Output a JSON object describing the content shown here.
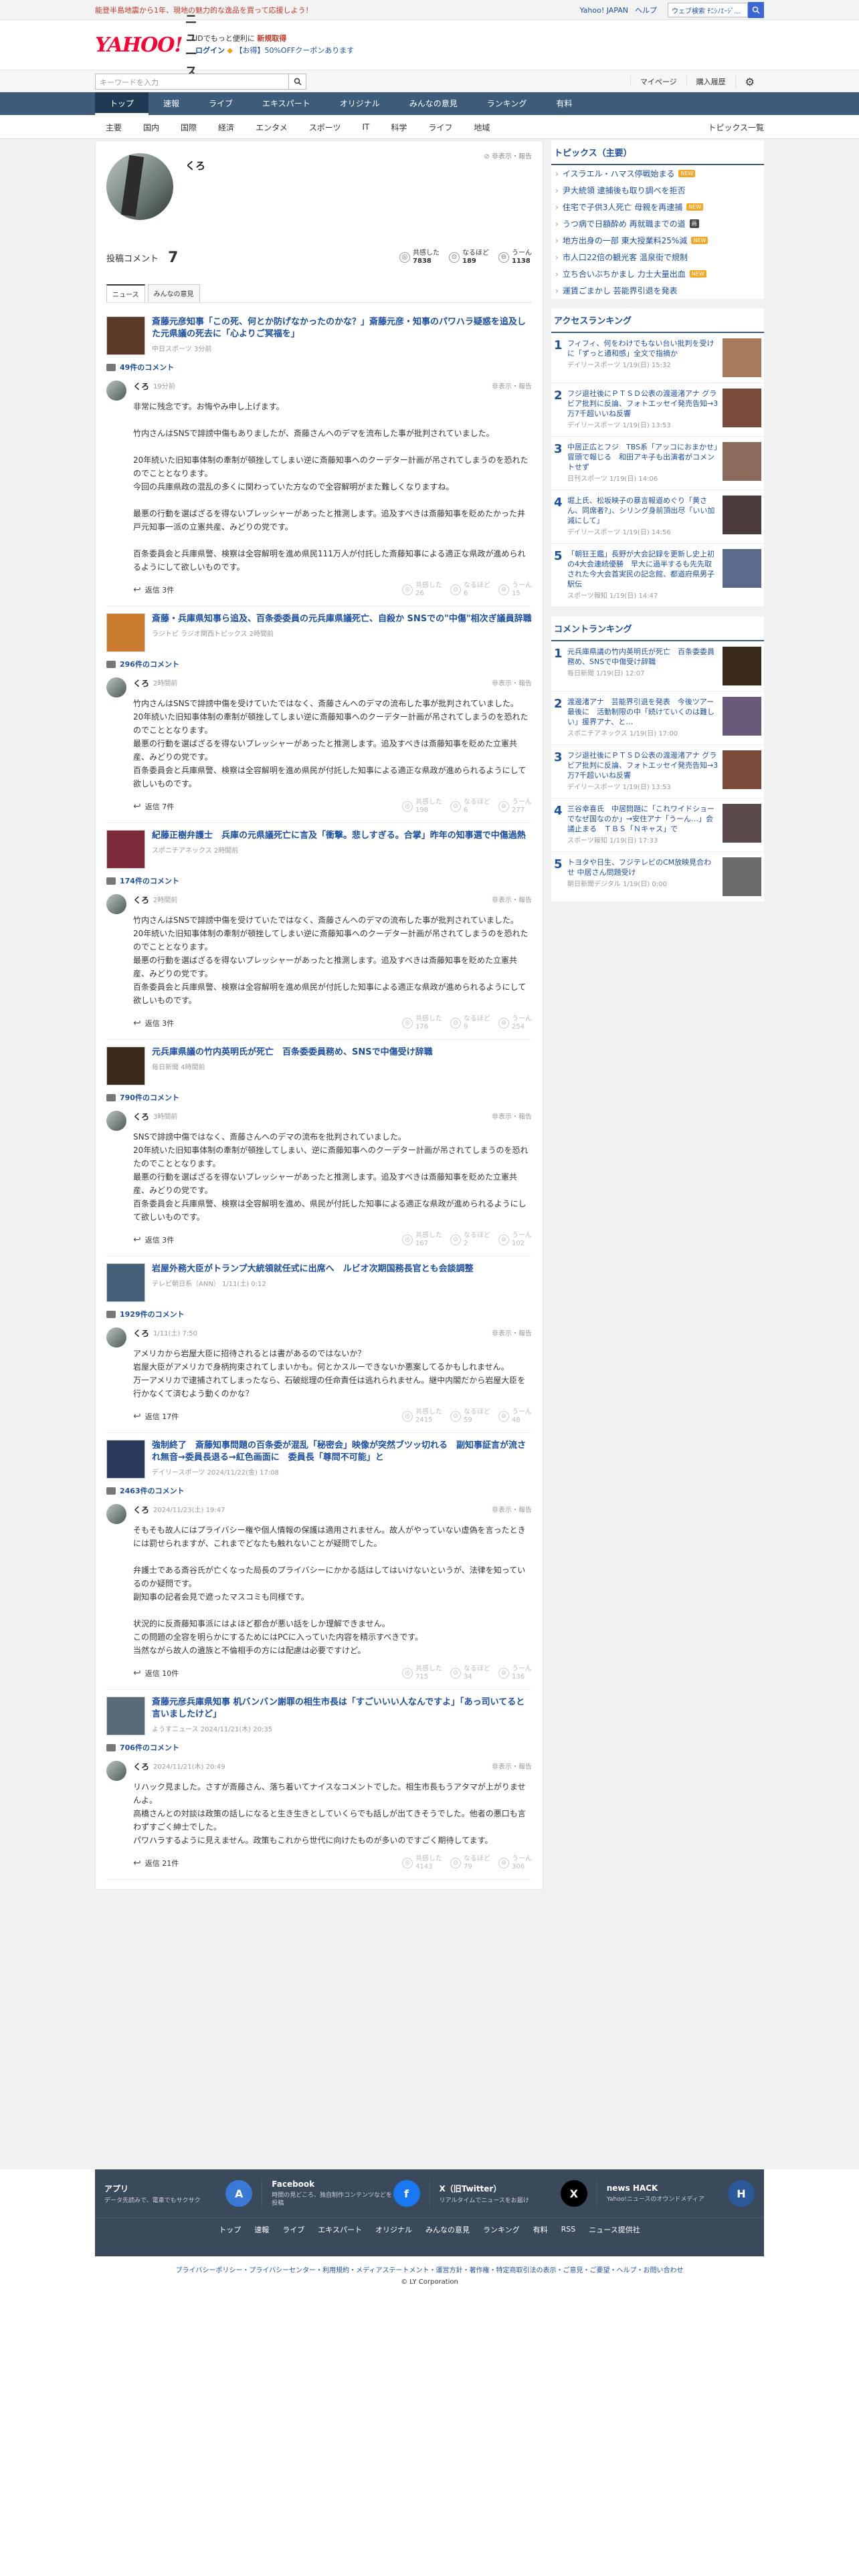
{
  "topbar": {
    "promo": "能登半島地震から1年、現地の魅力的な逸品を買って応援しよう！",
    "links": [
      "Yahoo! JAPAN",
      "ヘルプ"
    ],
    "search_placeholder": "ウェブ検索",
    "search_value": "ﾁﾆｼﾉｴｰｼﾞ..."
  },
  "header": {
    "logo": "YAHOO!",
    "logo_sub": "JAPAN",
    "site": "ニュース",
    "msg1": "IDでもっと便利に",
    "msg1_link": "新規取得",
    "login": "ログイン",
    "coupon": "【お得】50%OFFクーポンあります"
  },
  "subhead": {
    "search_placeholder": "キーワードを入力",
    "mypage": "マイページ",
    "history": "購入履歴"
  },
  "gnav": [
    "トップ",
    "速報",
    "ライブ",
    "エキスパート",
    "オリジナル",
    "みんなの意見",
    "ランキング",
    "有料"
  ],
  "cnav": {
    "items": [
      "主要",
      "国内",
      "国際",
      "経済",
      "エンタメ",
      "スポーツ",
      "IT",
      "科学",
      "ライフ",
      "地域"
    ],
    "all": "トピックス一覧"
  },
  "profile": {
    "name": "くろ",
    "report": "非表示・報告",
    "label": "投稿コメント",
    "count": "7",
    "stats": [
      {
        "label": "共感した",
        "value": "7838",
        "icon": "◎"
      },
      {
        "label": "なるほど",
        "value": "189",
        "icon": "⊙"
      },
      {
        "label": "うーん",
        "value": "1138",
        "icon": "⊖"
      }
    ],
    "tabs": [
      "ニュース",
      "みんなの意見"
    ]
  },
  "items": [
    {
      "title": "斎藤元彦知事「この死、何とか防げなかったのかな？」斎藤元彦・知事のパワハラ疑惑を追及した元県議の死去に「心よりご冥福を」",
      "source": "中日スポーツ 3分前",
      "thumb": "#5b3a2a",
      "ccount": "49件のコメント",
      "user": "くろ",
      "time": "19分前",
      "text": "非常に残念です。お悔やみ申し上げます。\n\n竹内さんはSNSで誹謗中傷もありましたが、斎藤さんへのデマを流布した事が批判されていました。\n\n20年続いた旧知事体制の牽制が頓挫してしまい逆に斎藤知事へのクーデター計画が吊されてしまうのを恐れたのでこととなります。\n今回の兵庫県政の混乱の多くに関わっていた方なので全容解明がまた難しくなりますね。\n\n最悪の行動を選ばざるを得ないプレッシャーがあったと推測します。追及すべきは斎藤知事を貶めたかった井戸元知事一派の立憲共産、みどりの党です。\n\n百条委員会と兵庫県警、検察は全容解明を進め県民111万人が付託した斎藤知事による適正な県政が進められるようにして欲しいものです。",
      "reply": "返信 3件",
      "r": [
        "26",
        "6",
        "15"
      ]
    },
    {
      "title": "斎藤・兵庫県知事ら追及、百条委委員の元兵庫県議死亡、自殺か SNSでの\"中傷\"相次ぎ議員辞職",
      "source": "ラジトピ ラジオ関西トピックス 2時間前",
      "thumb": "#c97c2e",
      "ccount": "296件のコメント",
      "user": "くろ",
      "time": "2時間前",
      "text": "竹内さんはSNSで誹謗中傷を受けていたではなく、斎藤さんへのデマの流布した事が批判されていました。\n20年続いた旧知事体制の牽制が頓挫してしまい逆に斎藤知事へのクーデター計画が吊されてしまうのを恐れたのでこととなります。\n最悪の行動を選ばざるを得ないプレッシャーがあったと推測します。追及すべきは斎藤知事を貶めた立憲共産、みどりの党です。\n百条委員会と兵庫県警、検察は全容解明を進め県民が付託した知事による適正な県政が進められるようにして欲しいものです。",
      "reply": "返信 7件",
      "r": [
        "198",
        "6",
        "277"
      ]
    },
    {
      "title": "紀藤正樹弁護士　兵庫の元県議死亡に言及「衝撃。悲しすぎる。合掌」昨年の知事選で中傷過熱",
      "source": "スポニチアネックス 2時間前",
      "thumb": "#7a2a3a",
      "ccount": "174件のコメント",
      "user": "くろ",
      "time": "2時間前",
      "text": "竹内さんはSNSで誹謗中傷を受けていたではなく、斎藤さんへのデマの流布した事が批判されていました。\n20年続いた旧知事体制の牽制が頓挫してしまい逆に斎藤知事へのクーデター計画が吊されてしまうのを恐れたのでこととなります。\n最悪の行動を選ばざるを得ないプレッシャーがあったと推測します。追及すべきは斎藤知事を貶めた立憲共産、みどりの党です。\n百条委員会と兵庫県警、検察は全容解明を進め県民が付託した知事による適正な県政が進められるようにして欲しいものです。",
      "reply": "返信 3件",
      "r": [
        "176",
        "9",
        "254"
      ]
    },
    {
      "title": "元兵庫県議の竹内英明氏が死亡　百条委委員務め、SNSで中傷受け辞職",
      "source": "毎日新聞 4時間前",
      "thumb": "#3a2a1a",
      "ccount": "790件のコメント",
      "user": "くろ",
      "time": "3時間前",
      "text": "SNSで誹謗中傷ではなく、斎藤さんへのデマの流布を批判されていました。\n20年続いた旧知事体制の牽制が頓挫してしまい、逆に斎藤知事へのクーデター計画が吊されてしまうのを恐れたのでこととなります。\n最悪の行動を選ばざるを得ないプレッシャーがあったと推測します。追及すべきは斎藤知事を貶めた立憲共産、みどりの党です。\n百条委員会と兵庫県警、検察は全容解明を進め、県民が付託した知事による適正な県政が進められるようにして欲しいものです。",
      "reply": "返信 3件",
      "r": [
        "167",
        "2",
        "102"
      ]
    },
    {
      "title": "岩屋外務大臣がトランプ大統領就任式に出席へ　ルビオ次期国務長官とも会談調整",
      "source": "テレビ朝日系（ANN） 1/11(土) 0:12",
      "thumb": "#46607a",
      "ccount": "1929件のコメント",
      "user": "くろ",
      "time": "1/11(土) 7:50",
      "text": "アメリカから岩屋大臣に招待されるとは書があるのではないか？\n岩屋大臣がアメリカで身柄拘束されてしまいかも。何とかスルーできないか悪案してるかもしれません。\n万一アメリカで逮捕されてしまったなら、石破総理の任命責任は逃れられません。継中内閣だから岩屋大臣を行かなくて済むよう動くのかな？",
      "reply": "返信 17件",
      "r": [
        "2415",
        "59",
        "48"
      ]
    },
    {
      "title": "強制終了　斎藤知事問題の百条委が混乱「秘密会」映像が突然ブツッ切れる　副知事証言が流され無音→委員長退る→紅色画面に　委員長「尊問不可能」と",
      "source": "デイリースポーツ 2024/11/22(金) 17:08",
      "thumb": "#2a3a5a",
      "ccount": "2463件のコメント",
      "user": "くろ",
      "time": "2024/11/23(土) 19:47",
      "text": "そもそも故人にはプライバシー権や個人情報の保護は適用されません。故人がやっていない虚偽を言ったときには罰せられますが、これまでどなたも触れないことが疑問でした。\n\n弁護士である斎谷氏が亡くなった局長のプライバシーにかかる話はしてはいけないというが、法律を知っているのか疑問です。\n副知事の記者会見で遮ったマスコミも同様です。\n\n状況的に反斎藤知事派にはよほど都合が悪い話をしか理解できません。\nこの問題の全容を明らかにするためにはPCに入っていた内容を精示すべきです。\n当然ながら故人の遺族と不倫相手の方には配慮は必要ですけど。",
      "reply": "返信 10件",
      "r": [
        "715",
        "34",
        "136"
      ]
    },
    {
      "title": "斎藤元彦兵庫県知事 机バンバン謝罪の相生市長は「すごいいい人なんですよ」「あっ司いてると言いましたけど」",
      "source": "ようすニュース 2024/11/21(木) 20:35",
      "thumb": "#5a6a7a",
      "ccount": "706件のコメント",
      "user": "くろ",
      "time": "2024/11/21(木) 20:49",
      "text": "リハック見ました。さすが斎藤さん、落ち着いてナイスなコメントでした。相生市長もうアタマが上がりませんよ。\n高橋さんとの対談は政策の話しになると生き生きとしていくらでも話しが出てきそうでした。他者の悪口も言わずすごく紳士でした。\nパワハラするように見えません。政策もこれから世代に向けたものが多いのですごく期待してます。",
      "reply": "返信 21件",
      "r": [
        "4143",
        "79",
        "306"
      ]
    }
  ],
  "side": {
    "topics_title": "トピックス（主要）",
    "topics": [
      {
        "t": "イスラエル・ハマス停戦始まる",
        "b": "NEW"
      },
      {
        "t": "尹大統領 逮捕後も取り調べを拒否",
        "b": ""
      },
      {
        "t": "住宅で子供3人死亡 母親を再逮捕",
        "b": "NEW"
      },
      {
        "t": "うつ病で日額酔め 再就職までの道",
        "b": "画"
      },
      {
        "t": "地方出身の一部 東大授業料25%減",
        "b": "NEW"
      },
      {
        "t": "市人口22倍の観光客 温泉街で規制",
        "b": ""
      },
      {
        "t": "立ち合いぶちかまし 力士大量出血",
        "b": "NEW"
      },
      {
        "t": "運賃ごまかし 芸能界引退を発表",
        "b": ""
      }
    ],
    "access_title": "アクセスランキング",
    "access": [
      {
        "no": "1",
        "t": "フィフィ、何をわけでもない台い批判を受けに「ずっと通和感」全文で指摘か",
        "s": "デイリースポーツ 1/19(日) 15:32",
        "c": "#a67a5a"
      },
      {
        "no": "2",
        "t": "フジ退社後にＰＴＳＤ公表の渡邊渚アナ グラビア批判に反論、フォトエッセイ発売告知→3万7千超いいね反響",
        "s": "デイリースポーツ 1/19(日) 13:53",
        "c": "#7a4a3a"
      },
      {
        "no": "3",
        "t": "中居正広とフジ　TBS系「アッコにおまかせ」冒頭で報じる　和田アキ子も出演者がコメントせず",
        "s": "日刊スポーツ 1/19(日) 14:06",
        "c": "#8a6a5a"
      },
      {
        "no": "4",
        "t": "堀上氏、松坂映子の暴言報道めぐり「黄さん、同席者?」、シリング身前頂出尽「いい加減にして」",
        "s": "デイリースポーツ 1/19(日) 14:56",
        "c": "#4a3a3a"
      },
      {
        "no": "5",
        "t": "「朝狂王鑑」長野が大会記録を更新し史上初の4大会連続優勝　早大に過半するも先先取された今大会首実民の記念館、都道府県男子駅伝",
        "s": "スポーツ報知 1/19(日) 14:47",
        "c": "#5a6a8a"
      }
    ],
    "comment_title": "コメントランキング",
    "comment": [
      {
        "no": "1",
        "t": "元兵庫県議の竹内英明氏が死亡　百条委委員務め、SNSで中傷受け辞職",
        "s": "毎日新聞 1/19(日) 12:07",
        "c": "#3a2a1a"
      },
      {
        "no": "2",
        "t": "渡邊渚アナ　芸能界引退を発表　今後ツアー最後に　活動制限の中「続けていくのは難しい」援界アナ、と…",
        "s": "スポニチアネックス 1/19(日) 17:00",
        "c": "#6a5a7a"
      },
      {
        "no": "3",
        "t": "フジ退社後にＰＴＳＤ公表の渡邊渚アナ グラビア批判に反論、フォトエッセイ発売告知→3万7千超いいね反響",
        "s": "デイリースポーツ 1/19(日) 13:53",
        "c": "#7a4a3a"
      },
      {
        "no": "4",
        "t": "三谷幸喜氏　中居問題に「これワイドショーでなぜ国なのか」→安住アナ「うーん…」会議止まる　ＴＢＳ「Ｎキャス」で",
        "s": "スポーツ報知 1/19(日) 17:33",
        "c": "#5a4a4a"
      },
      {
        "no": "5",
        "t": "トヨタや日生、フジテレビのCM放映見合わせ 中居さん問題受け",
        "s": "朝日新聞デジタル 1/19(日) 0:00",
        "c": "#6a6a6a"
      }
    ]
  },
  "footer": {
    "apps": [
      {
        "t": "アプリ",
        "d": "データ先読みで、電車でもサクサク",
        "ic": "A",
        "c": "#3a7ad6"
      },
      {
        "t": "Facebook",
        "d": "時間の見どころ、独自制作コンテンツなどを投稿",
        "ic": "f",
        "c": "#1877f2"
      },
      {
        "t": "X（旧Twitter）",
        "d": "リアルタイムでニュースをお届け",
        "ic": "X",
        "c": "#000"
      },
      {
        "t": "news HACK",
        "d": "Yahoo!ニュースのオウンドメディア",
        "ic": "H",
        "c": "#2a5a9a"
      }
    ],
    "nav": [
      "トップ",
      "速報",
      "ライブ",
      "エキスパート",
      "オリジナル",
      "みんなの意見",
      "ランキング",
      "有料",
      "RSS",
      "ニュース提供社"
    ],
    "legal": "プライバシーポリシー・プライバシーセンター・利用規約・メディアステートメント・運営方針・著作権・特定商取引法の表示・ご意見・ご要望・ヘルプ・お問い合わせ",
    "copy": "© LY Corporation"
  }
}
